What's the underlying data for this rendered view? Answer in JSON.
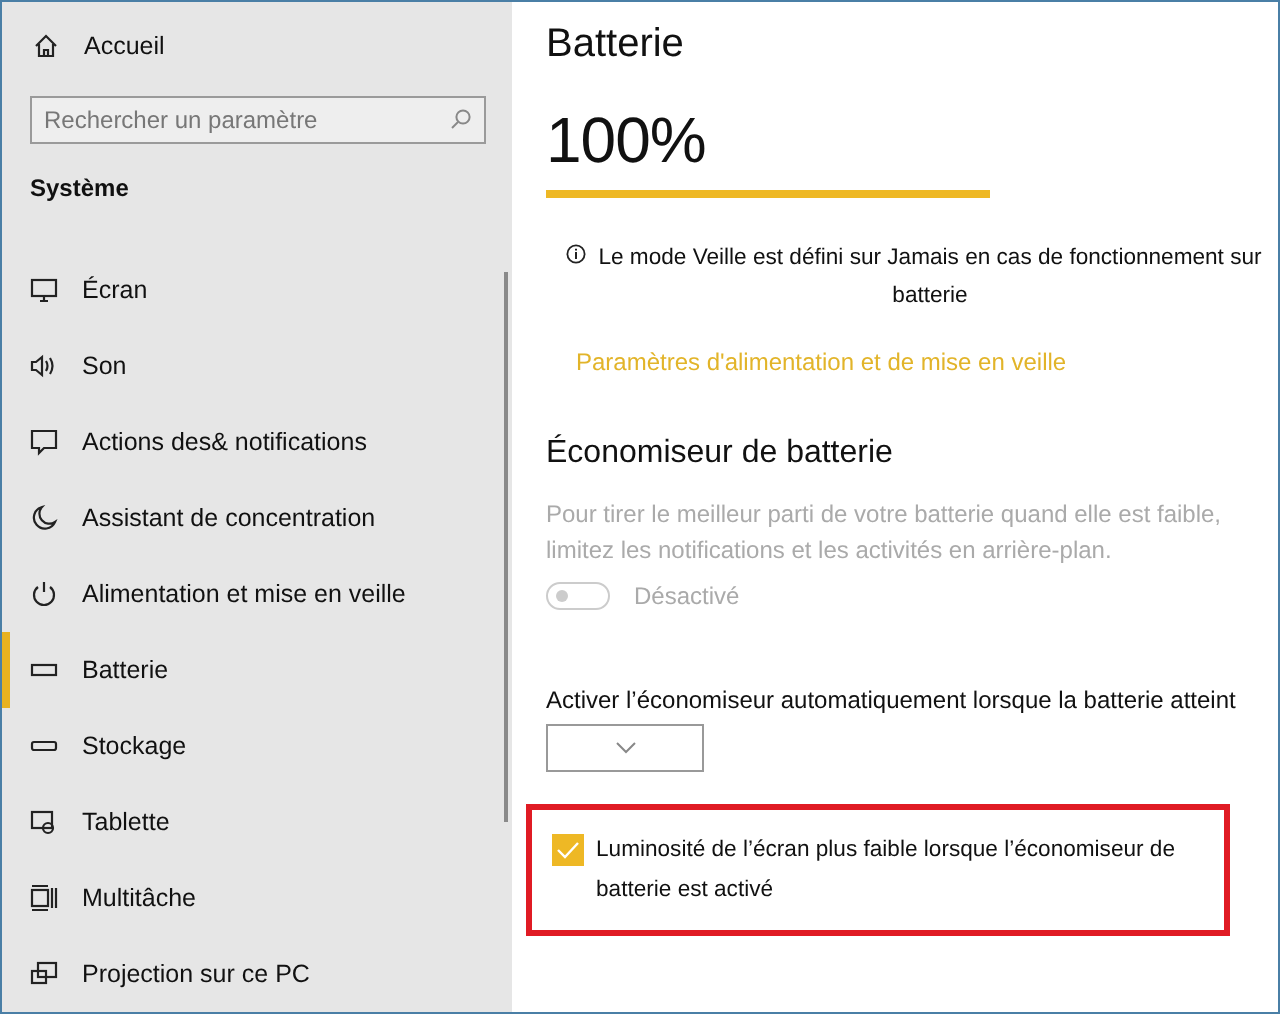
{
  "sidebar": {
    "home": "Accueil",
    "search": {
      "placeholder": "Rechercher un paramètre"
    },
    "section": "Système",
    "items": [
      {
        "label": "Écran",
        "selected": false
      },
      {
        "label": "Son",
        "selected": false
      },
      {
        "label": "Actions des& notifications",
        "selected": false
      },
      {
        "label": "Assistant de concentration",
        "selected": false
      },
      {
        "label": "Alimentation et mise en veille",
        "selected": false
      },
      {
        "label": "Batterie",
        "selected": true
      },
      {
        "label": "Stockage",
        "selected": false
      },
      {
        "label": "Tablette",
        "selected": false
      },
      {
        "label": "Multitâche",
        "selected": false
      },
      {
        "label": "Projection sur ce PC",
        "selected": false
      }
    ]
  },
  "main": {
    "title": "Batterie",
    "percent": "100%",
    "level": 1,
    "info": "Le mode Veille est défini sur Jamais en cas de fonctionnement sur batterie",
    "link": "Paramètres d'alimentation et de mise en veille",
    "saver": {
      "heading": "Économiseur de batterie",
      "description": "Pour tirer le meilleur parti de votre batterie quand elle est faible, limitez les notifications et les activités en arrière-plan.",
      "toggle": {
        "on": false,
        "disabled": true,
        "label": "Désactivé"
      },
      "auto_label": "Activer l’économiseur automatiquement lorsque la batterie atteint",
      "checkbox": {
        "checked": true,
        "highlighted": true,
        "label": "Luminosité de l’écran plus faible lorsque l’économiseur de batterie est activé"
      }
    }
  }
}
